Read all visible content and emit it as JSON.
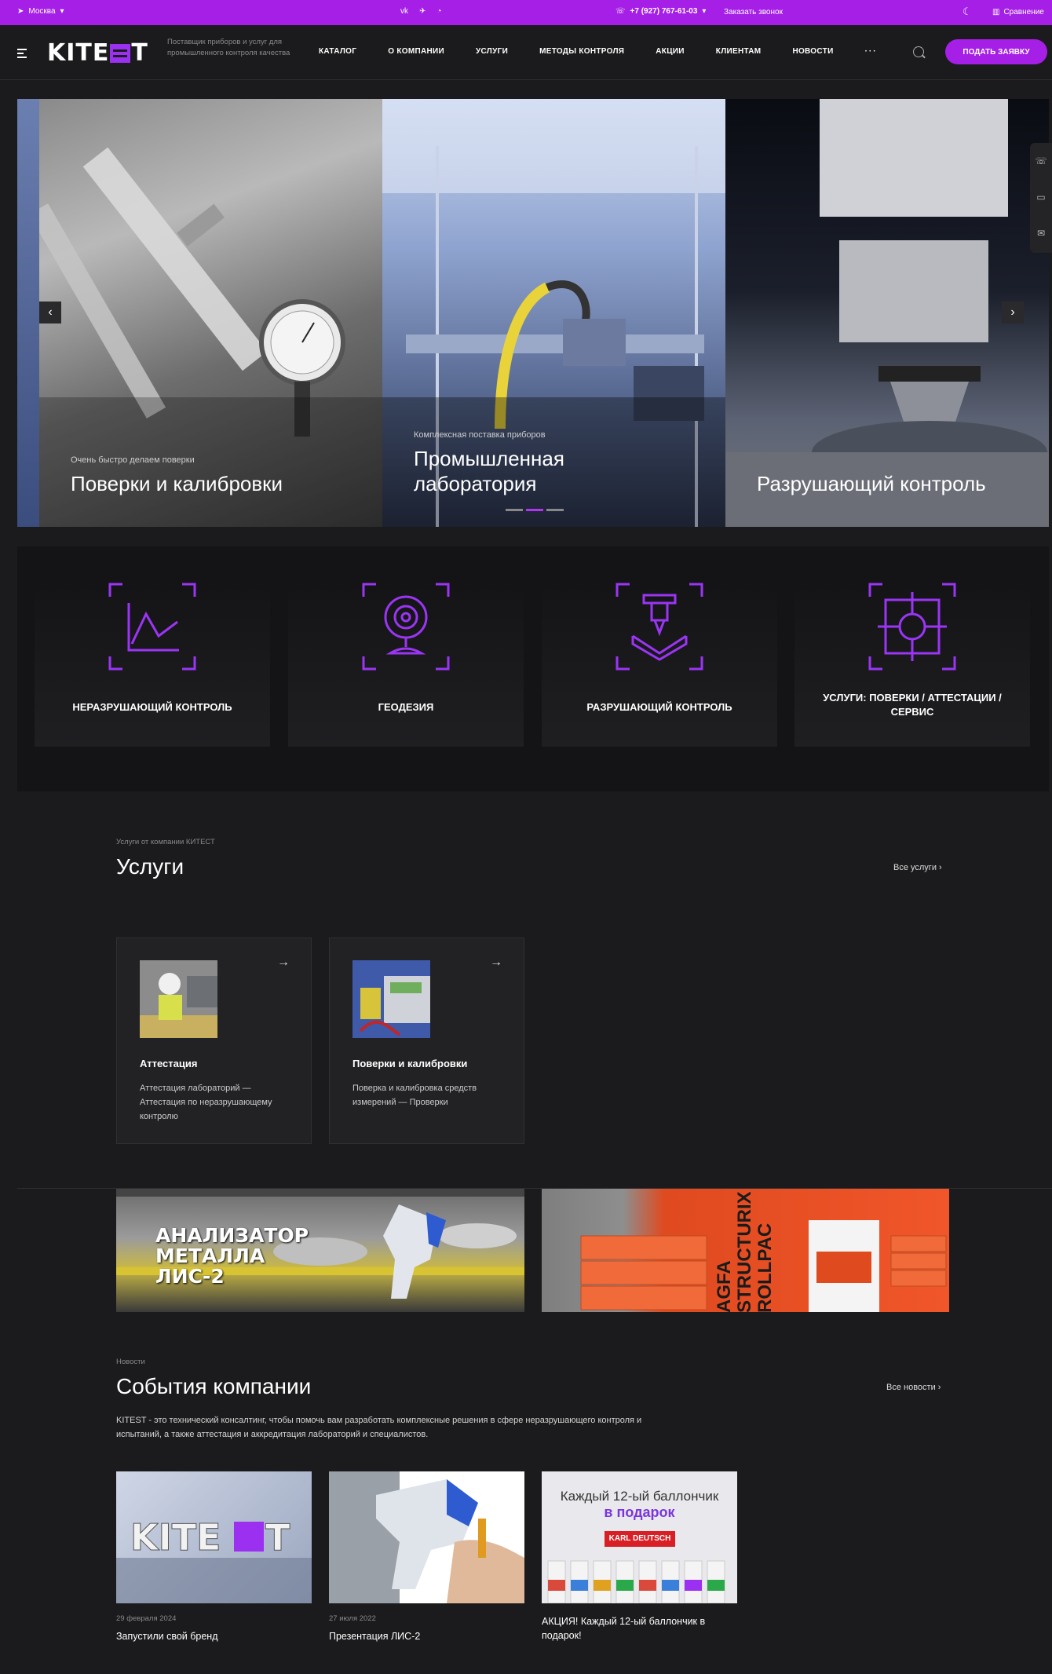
{
  "topbar": {
    "city": "Москва",
    "phone": "+7 (927) 767-61-03",
    "callback": "Заказать звонок",
    "compare": "Сравнение"
  },
  "header": {
    "logo": "KITEST",
    "tagline": "Поставщик приборов и услуг для промышленного контроля качества",
    "nav": [
      "КАТАЛОГ",
      "О КОМПАНИИ",
      "УСЛУГИ",
      "МЕТОДЫ КОНТРОЛЯ",
      "АКЦИИ",
      "КЛИЕНТАМ",
      "НОВОСТИ"
    ],
    "more": "···",
    "apply": "ПОДАТЬ ЗАЯВКУ"
  },
  "hero": {
    "slides": [
      {
        "small": "Очень быстро делаем поверки",
        "big": "Поверки и калибровки"
      },
      {
        "small": "Комплексная поставка приборов",
        "big": "Промышленная лаборатория"
      },
      {
        "small": "",
        "big": "Разрушающий контроль"
      }
    ],
    "prev": "‹",
    "next": "›"
  },
  "categories": [
    "НЕРАЗРУШАЮЩИЙ КОНТРОЛЬ",
    "ГЕОДЕЗИЯ",
    "РАЗРУШАЮЩИЙ КОНТРОЛЬ",
    "УСЛУГИ: ПОВЕРКИ / АТТЕСТАЦИИ / СЕРВИС"
  ],
  "services": {
    "subtitle": "Услуги от компании КИТЕСТ",
    "title": "Услуги",
    "all": "Все услуги  ›",
    "items": [
      {
        "title": "Аттестация",
        "desc": "Аттестация лабораторий  —  Аттестация по неразрушающему контролю"
      },
      {
        "title": "Поверки и калибровки",
        "desc": "Поверка и калибровка средств измерений  —  Проверки"
      }
    ]
  },
  "banners": {
    "b1": "АНАЛИЗАТОР МЕТАЛЛА ЛИС-2",
    "b2": "AGFA STRUCTURIX ROLLPAC"
  },
  "news": {
    "subtitle": "Новости",
    "title": "События компании",
    "all": "Все новости  ›",
    "desc": "KITEST - это технический консалтинг, чтобы помочь вам разработать комплексные решения в сфере неразрушающего контроля и испытаний, а также аттестация и аккредитация лабораторий и специалистов.",
    "items": [
      {
        "date": "29 февраля 2024",
        "title": "Запустили свой бренд"
      },
      {
        "date": "27 июля 2022",
        "title": "Презентация ЛИС-2"
      },
      {
        "date": "",
        "title": "АКЦИЯ! Каждый 12-ый баллончик в подарок!"
      }
    ],
    "promo_line1": "Каждый 12-ый баллончик",
    "promo_line2": "в подарок",
    "promo_brand": "KARL DEUTSCH"
  },
  "colors": {
    "accent": "#a51fe6",
    "bg": "#1b1b1d"
  }
}
